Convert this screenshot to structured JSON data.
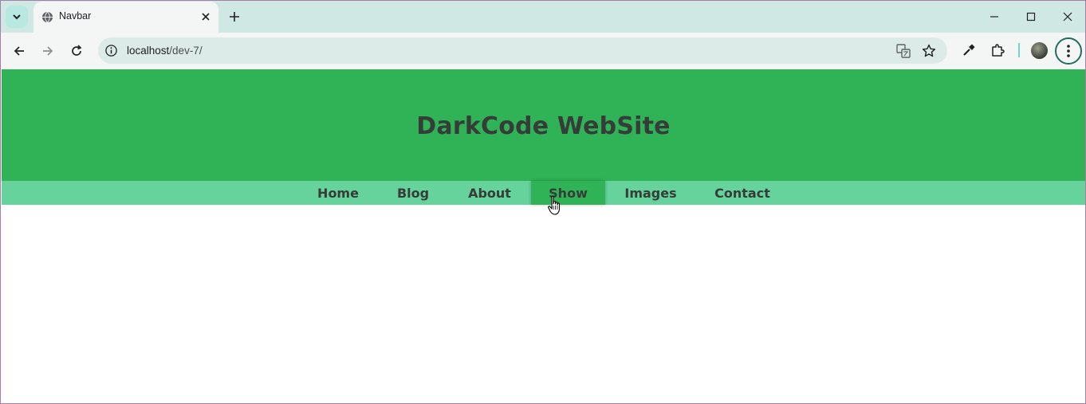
{
  "browser": {
    "tab_title": "Navbar",
    "url_host": "localhost",
    "url_path": "/dev-7/"
  },
  "site": {
    "title": "DarkCode WebSite",
    "nav": [
      {
        "label": "Home"
      },
      {
        "label": "Blog"
      },
      {
        "label": "About"
      },
      {
        "label": "Show",
        "active": true
      },
      {
        "label": "Images"
      },
      {
        "label": "Contact"
      }
    ]
  },
  "colors": {
    "header_bg": "#30b357",
    "navbar_bg": "#66d29c",
    "text": "#363c38"
  },
  "icons": {
    "tab_search": "chevron-down-icon",
    "favicon": "globe-icon",
    "close_tab": "close-icon",
    "new_tab": "plus-icon",
    "minimize": "minimize-icon",
    "maximize": "maximize-icon",
    "close_window": "close-icon",
    "back": "back-arrow-icon",
    "forward": "forward-arrow-icon",
    "reload": "reload-icon",
    "site_info": "info-icon",
    "translate": "translate-icon",
    "bookmark": "star-icon",
    "eyedropper": "eyedropper-icon",
    "extensions": "puzzle-icon",
    "menu": "more-vert-icon"
  }
}
